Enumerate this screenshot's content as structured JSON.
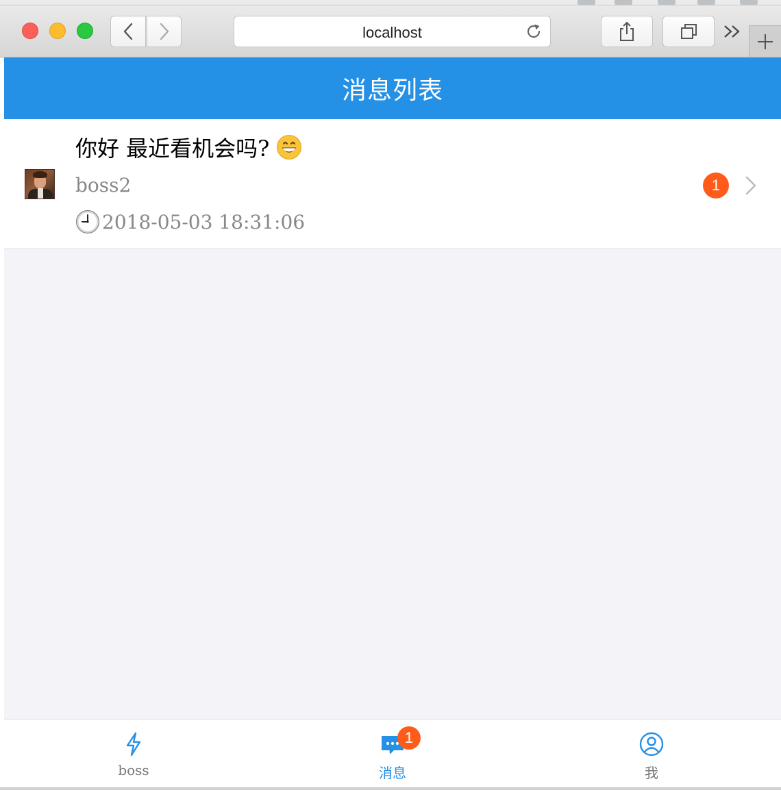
{
  "browser": {
    "address": "localhost",
    "icons": [
      "back-icon",
      "forward-icon",
      "reload-icon",
      "share-icon",
      "tabs-icon",
      "overflow-icon",
      "new-tab-icon"
    ]
  },
  "header": {
    "title": "消息列表"
  },
  "messages": [
    {
      "text": "你好 最近看机会吗?",
      "emoji": "grinning-face-icon",
      "sender": "boss2",
      "time": "2018-05-03 18:31:06",
      "unread": "1"
    }
  ],
  "tabbar": {
    "tabs": [
      {
        "label": "boss",
        "icon": "lightning-icon",
        "active": false
      },
      {
        "label": "消息",
        "icon": "chat-icon",
        "active": true,
        "badge": "1"
      },
      {
        "label": "我",
        "icon": "user-icon",
        "active": false
      }
    ]
  },
  "colors": {
    "primary": "#2490e6",
    "badge": "#ff5b1a",
    "background": "#f4f4f8",
    "secondary_text": "#888888"
  }
}
